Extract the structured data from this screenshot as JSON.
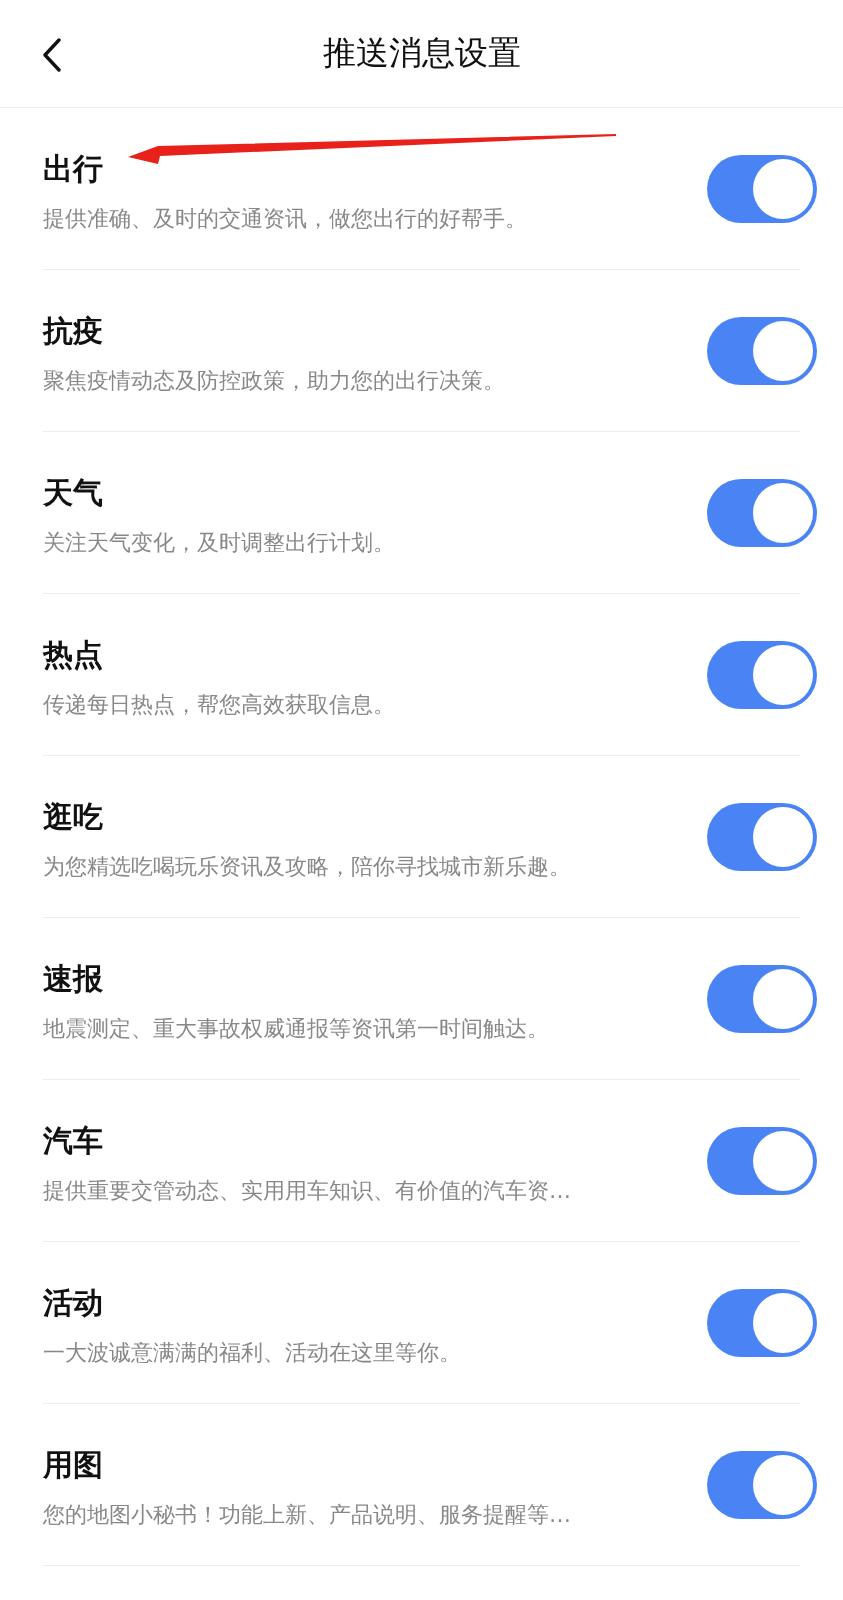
{
  "header": {
    "title": "推送消息设置"
  },
  "settings": [
    {
      "title": "出行",
      "description": "提供准确、及时的交通资讯，做您出行的好帮手。",
      "on": true
    },
    {
      "title": "抗疫",
      "description": "聚焦疫情动态及防控政策，助力您的出行决策。",
      "on": true
    },
    {
      "title": "天气",
      "description": "关注天气变化，及时调整出行计划。",
      "on": true
    },
    {
      "title": "热点",
      "description": "传递每日热点，帮您高效获取信息。",
      "on": true
    },
    {
      "title": "逛吃",
      "description": "为您精选吃喝玩乐资讯及攻略，陪你寻找城市新乐趣。",
      "on": true
    },
    {
      "title": "速报",
      "description": "地震测定、重大事故权威通报等资讯第一时间触达。",
      "on": true
    },
    {
      "title": "汽车",
      "description": "提供重要交管动态、实用用车知识、有价值的汽车资…",
      "on": true
    },
    {
      "title": "活动",
      "description": "一大波诚意满满的福利、活动在这里等你。",
      "on": true
    },
    {
      "title": "用图",
      "description": "您的地图小秘书！功能上新、产品说明、服务提醒等…",
      "on": true
    }
  ]
}
